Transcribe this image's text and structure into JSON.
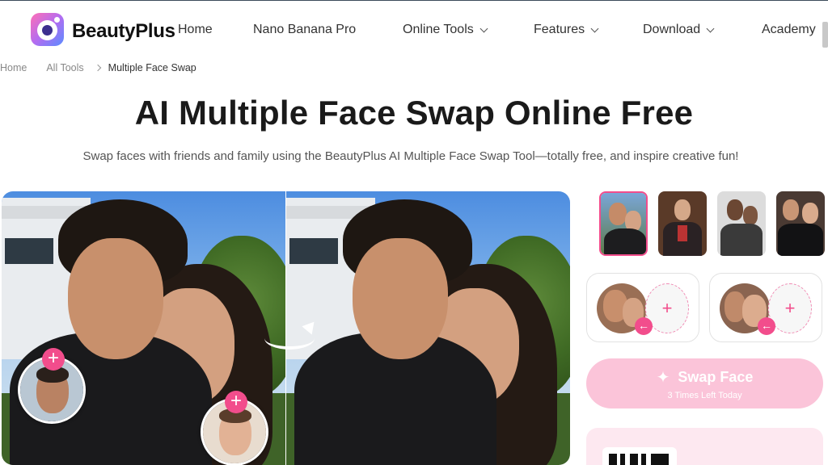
{
  "header": {
    "brand": "BeautyPlus",
    "nav": [
      {
        "label": "Home",
        "has_dropdown": false
      },
      {
        "label": "Nano Banana Pro",
        "has_dropdown": false
      },
      {
        "label": "Online Tools",
        "has_dropdown": true
      },
      {
        "label": "Features",
        "has_dropdown": true
      },
      {
        "label": "Download",
        "has_dropdown": true
      },
      {
        "label": "Academy",
        "has_dropdown": false
      }
    ]
  },
  "breadcrumb": [
    "Home",
    "All Tools",
    "Multiple Face Swap"
  ],
  "hero": {
    "title": "AI Multiple Face Swap Online Free",
    "subtitle": "Swap faces with friends and family using the BeautyPlus AI Multiple Face Swap Tool—totally free, and inspire creative fun!"
  },
  "panel": {
    "swap_button_label": "Swap Face",
    "swap_button_sub": "3 Times Left Today",
    "add_face_symbol": "+"
  },
  "colors": {
    "accent": "#f24d8c",
    "swap_button_bg": "#fbc4d9",
    "qr_card_bg": "#fde8f0"
  },
  "icons": {
    "logo": "beautyplus-camera-logo",
    "sparkle": "sparkle-icon",
    "plus": "plus-icon",
    "arrow_left": "arrow-left-icon",
    "chevron": "chevron-down-icon"
  }
}
